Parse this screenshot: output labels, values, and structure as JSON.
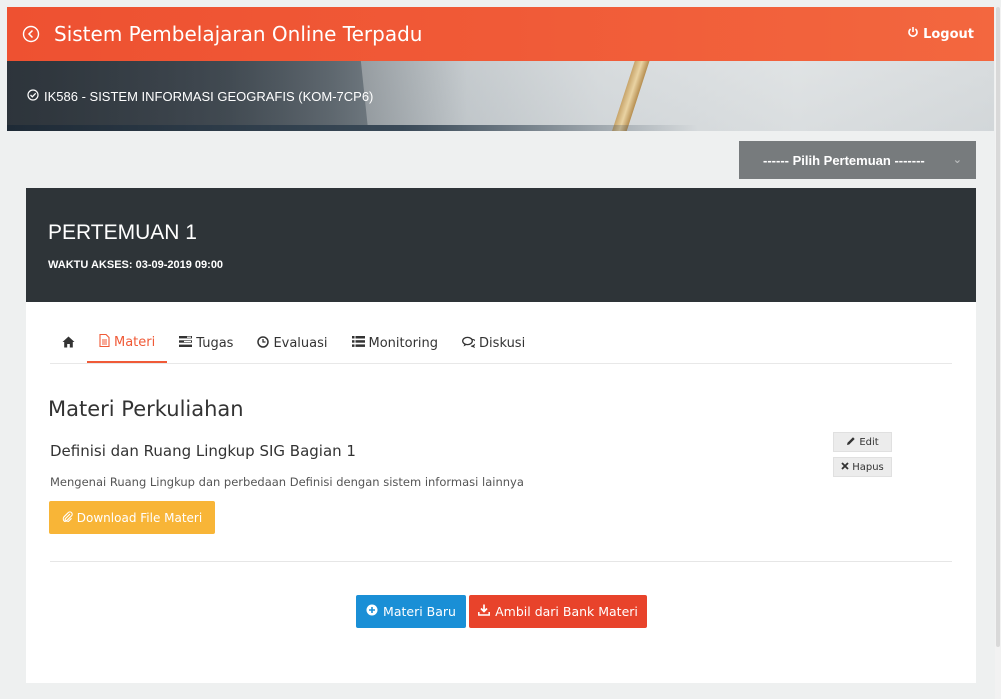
{
  "header": {
    "title": "Sistem Pembelajaran Online Terpadu",
    "logout_label": "Logout",
    "back_icon": "circle-arrow-left-icon",
    "logout_icon": "power-icon",
    "brand_color": "#f05a37"
  },
  "hero": {
    "course": "IK586 - SISTEM INFORMASI GEOGRAFIS (KOM-7CP6)",
    "course_icon": "check-circle-icon"
  },
  "meeting_select": {
    "selected": "------ Pilih Pertemuan -------"
  },
  "meeting": {
    "title": "PERTEMUAN 1",
    "access_time": "WAKTU AKSES: 03-09-2019 09:00"
  },
  "tabs": [
    {
      "label": "",
      "icon": "home-icon",
      "active": false
    },
    {
      "label": "Materi",
      "icon": "file-icon",
      "active": true
    },
    {
      "label": "Tugas",
      "icon": "tasks-icon",
      "active": false
    },
    {
      "label": "Evaluasi",
      "icon": "clock-icon",
      "active": false
    },
    {
      "label": "Monitoring",
      "icon": "list-icon",
      "active": false
    },
    {
      "label": "Diskusi",
      "icon": "comments-icon",
      "active": false
    }
  ],
  "content": {
    "section_title": "Materi Perkuliahan",
    "materi": {
      "title": "Definisi dan Ruang Lingkup SIG Bagian 1",
      "description": "Mengenai Ruang Lingkup dan perbedaan Definisi dengan sistem informasi lainnya",
      "download_label": "Download File Materi",
      "edit_label": "Edit",
      "delete_label": "Hapus"
    },
    "new_button": "Materi Baru",
    "bank_button": "Ambil dari Bank Materi"
  },
  "colors": {
    "accent_orange": "#f05a37",
    "download_yellow": "#f8b537",
    "new_blue": "#1a8fd6",
    "bank_red": "#e8432b",
    "header_dark": "#2e3438"
  }
}
